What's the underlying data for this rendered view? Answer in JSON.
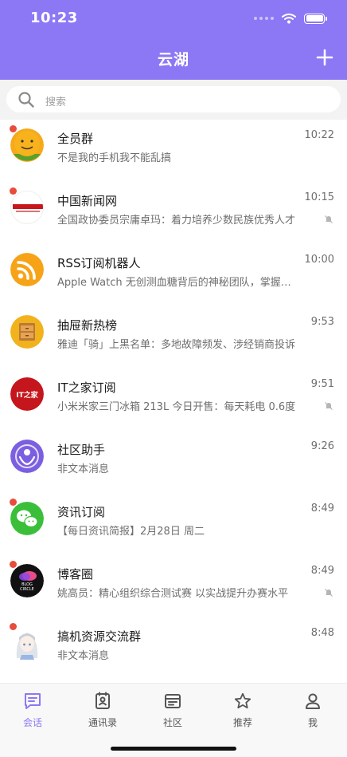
{
  "status": {
    "time": "10:23"
  },
  "header": {
    "title": "云湖",
    "add_icon": "plus-icon"
  },
  "search": {
    "placeholder": "搜索"
  },
  "conversations": [
    {
      "name": "全员群",
      "message": "不是我的手机我不能乱搞",
      "time": "10:22",
      "unread": true,
      "muted": false,
      "avatar": "emoji-avatar"
    },
    {
      "name": "中国新闻网",
      "message": "全国政协委员宗庸卓玛：着力培养少数民族优秀人才",
      "time": "10:15",
      "unread": true,
      "muted": true,
      "avatar": "chinanews-logo"
    },
    {
      "name": "RSS订阅机器人",
      "message": "Apple Watch 无创测血糖背后的神秘团队，掌握核心技术",
      "time": "10:00",
      "unread": false,
      "muted": false,
      "avatar": "rss-logo"
    },
    {
      "name": "抽屉新热榜",
      "message": "雅迪「骑」上黑名单：多地故障频发、涉经销商投诉",
      "time": "9:53",
      "unread": false,
      "muted": false,
      "avatar": "drawer-logo"
    },
    {
      "name": "IT之家订阅",
      "message": "小米米家三门冰箱 213L 今日开售：每天耗电 0.6度",
      "time": "9:51",
      "unread": false,
      "muted": true,
      "avatar": "ithome-logo"
    },
    {
      "name": "社区助手",
      "message": "非文本消息",
      "time": "9:26",
      "unread": false,
      "muted": false,
      "avatar": "community-logo"
    },
    {
      "name": "资讯订阅",
      "message": "【每日资讯简报】2月28日 周二",
      "time": "8:49",
      "unread": true,
      "muted": false,
      "avatar": "chat-logo"
    },
    {
      "name": "博客圈",
      "message": "姚高员：精心组织综合测试赛 以实战提升办赛水平",
      "time": "8:49",
      "unread": true,
      "muted": true,
      "avatar": "blog-circle-logo"
    },
    {
      "name": "搞机资源交流群",
      "message": "非文本消息",
      "time": "8:48",
      "unread": true,
      "muted": false,
      "avatar": "anime-avatar"
    }
  ],
  "avatar_text": {
    "ithome": "IT之家",
    "blog_top": "BLOG",
    "blog_bottom": "CIRCLE"
  },
  "tabs": [
    {
      "label": "会话",
      "icon": "chat-icon",
      "active": true
    },
    {
      "label": "通讯录",
      "icon": "contacts-icon",
      "active": false
    },
    {
      "label": "社区",
      "icon": "community-icon",
      "active": false
    },
    {
      "label": "推荐",
      "icon": "star-icon",
      "active": false
    },
    {
      "label": "我",
      "icon": "person-icon",
      "active": false
    }
  ],
  "colors": {
    "accent": "#8c78f5",
    "unread_dot": "#e74c3c"
  }
}
